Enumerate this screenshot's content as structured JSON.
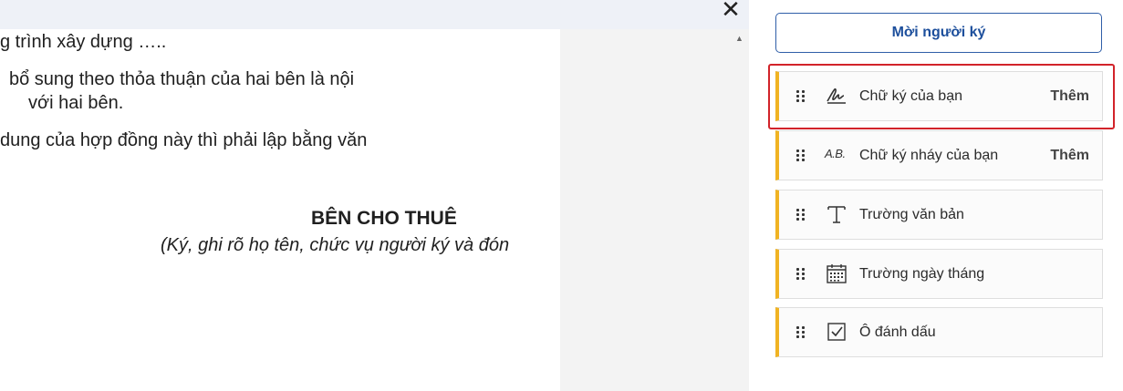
{
  "document": {
    "lines": [
      "g trình xây dựng …..",
      "bổ sung theo thỏa thuận của hai bên là nội",
      "với hai bên.",
      "dung của hợp đồng này thì phải lập bằng văn"
    ],
    "signature_block": {
      "heading": "BÊN CHO THUÊ",
      "note": "(Ký, ghi rõ họ tên, chức vụ người ký và đón"
    },
    "close_symbol": "✕"
  },
  "panel": {
    "invite_label": "Mời người ký",
    "fields": [
      {
        "label": "Chữ ký của bạn",
        "action": "Thêm",
        "icon": "signature-icon"
      },
      {
        "label": "Chữ ký nháy của bạn",
        "action": "Thêm",
        "icon": "initials-icon",
        "icon_text": "A.B."
      },
      {
        "label": "Trường văn bản",
        "action": "",
        "icon": "text-field-icon"
      },
      {
        "label": "Trường ngày tháng",
        "action": "",
        "icon": "calendar-icon"
      },
      {
        "label": "Ô đánh dấu",
        "action": "",
        "icon": "checkbox-icon"
      }
    ],
    "accent_color": "#f0b323",
    "highlight_color": "#d2232a"
  }
}
